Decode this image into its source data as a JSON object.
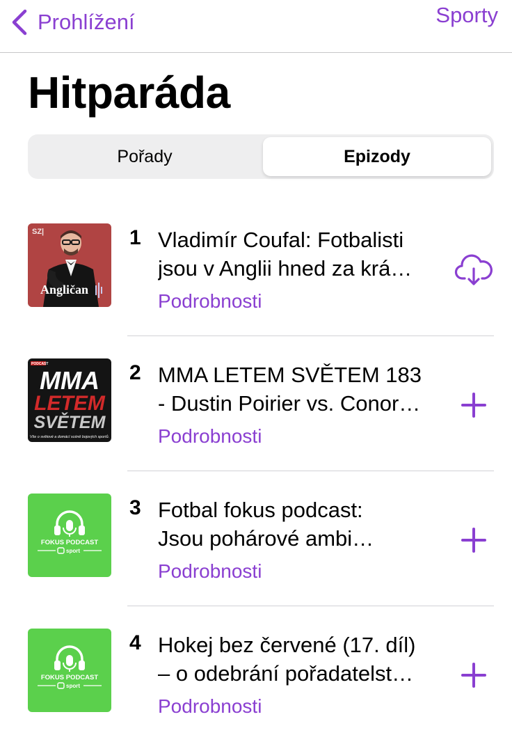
{
  "nav": {
    "back_label": "Prohlížení",
    "right_label": "Sporty"
  },
  "page": {
    "title": "Hitparáda"
  },
  "segments": {
    "left": "Pořady",
    "right": "Epizody",
    "selected": "Epizody"
  },
  "colors": {
    "accent": "#8a3fd1",
    "fokus_green": "#5bd04c",
    "anglican_red": "#b74947"
  },
  "episodes": [
    {
      "rank": "1",
      "title_line1": "Vladimír Coufal: Fotbalisti",
      "title_line2": "jsou v Anglii hned za krá…",
      "details": "Podrobnosti",
      "action": "download-cloud-icon",
      "artwork": {
        "badge": "SZ|",
        "name": "Angličan"
      }
    },
    {
      "rank": "2",
      "title_line1": "MMA LETEM SVĚTEM 183",
      "title_line2": "- Dustin Poirier vs. Conor…",
      "details": "Podrobnosti",
      "action": "plus-icon",
      "artwork": {
        "badge": "PODCAST",
        "w1": "MMA",
        "w2": "LETEM",
        "w3": "SVĚTEM",
        "tagline": "Vše o světové a domácí scéně bojových sportů."
      }
    },
    {
      "rank": "3",
      "title_line1": "Fotbal fokus podcast:",
      "title_line2": "Jsou pohárové ambi…",
      "details": "Podrobnosti",
      "action": "plus-icon",
      "artwork": {
        "name": "FOKUS PODCAST",
        "brand": "sport"
      }
    },
    {
      "rank": "4",
      "title_line1": "Hokej bez červené (17. díl)",
      "title_line2": "– o odebrání pořadatelst…",
      "details": "Podrobnosti",
      "action": "plus-icon",
      "artwork": {
        "name": "FOKUS PODCAST",
        "brand": "sport"
      }
    }
  ]
}
